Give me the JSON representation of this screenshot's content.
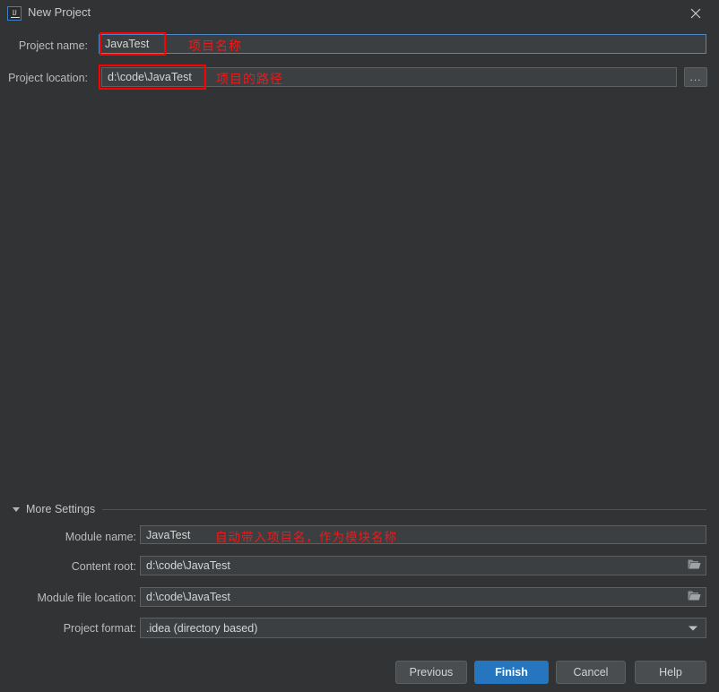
{
  "window": {
    "title": "New Project",
    "app_icon": "intellij-idea-icon",
    "close_icon": "close-icon"
  },
  "form": {
    "project_name": {
      "label": "Project name:",
      "value": "JavaTest",
      "annotation": "项目名称"
    },
    "project_location": {
      "label": "Project location:",
      "value": "d:\\code\\JavaTest",
      "annotation": "项目的路径",
      "browse_label": "..."
    }
  },
  "more_settings": {
    "label": "More Settings",
    "expanded": true,
    "toggle_icon": "chevron-down-icon",
    "rows": [
      {
        "label": "Module name:",
        "value": "JavaTest",
        "annotation": "自动带入项目名，作为模块名称",
        "icon": "",
        "type": "text"
      },
      {
        "label": "Content root:",
        "value": "d:\\code\\JavaTest",
        "annotation": "",
        "icon": "folder-icon",
        "type": "path"
      },
      {
        "label": "Module file location:",
        "value": "d:\\code\\JavaTest",
        "annotation": "",
        "icon": "folder-icon",
        "type": "path"
      },
      {
        "label": "Project format:",
        "value": ".idea (directory based)",
        "annotation": "",
        "icon": "chevron-down-icon",
        "type": "combo"
      }
    ]
  },
  "buttons": {
    "previous": "Previous",
    "finish": "Finish",
    "cancel": "Cancel",
    "help": "Help"
  },
  "colors": {
    "background": "#313335",
    "field_background": "#3c3f41",
    "focus_border": "#4a88c7",
    "primary_button": "#2675bf",
    "annotation_red": "#f01818",
    "highlight_box": "#ff0000"
  }
}
